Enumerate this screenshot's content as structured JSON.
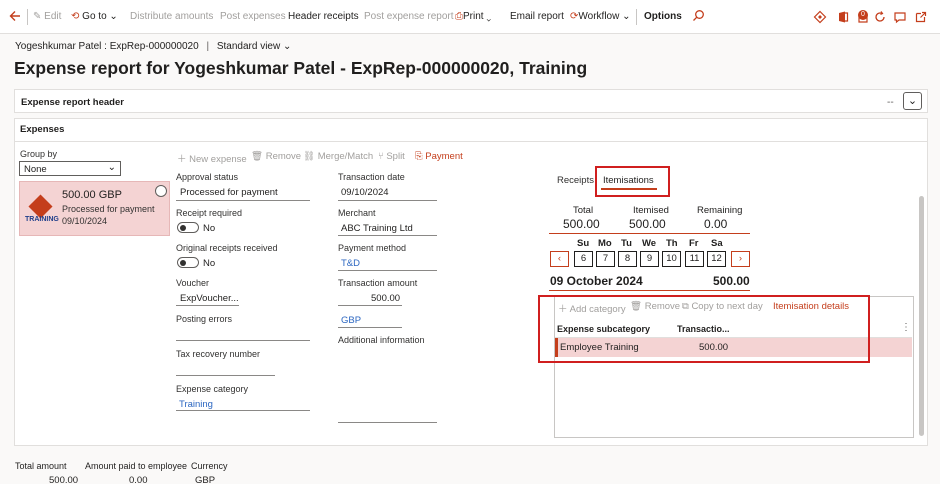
{
  "toolbar": {
    "edit": "Edit",
    "goto": "Go to",
    "distribute": "Distribute amounts",
    "post_expenses": "Post expenses",
    "header_receipts": "Header receipts",
    "post_report": "Post expense report",
    "print": "Print",
    "email_report": "Email report",
    "workflow": "Workflow",
    "options": "Options",
    "notification_count": "0"
  },
  "breadcrumb": {
    "record": "Yogeshkumar Patel : ExpRep-000000020",
    "view": "Standard view"
  },
  "page_title": "Expense report for Yogeshkumar Patel - ExpRep-000000020, Training",
  "header_section": {
    "title": "Expense report header",
    "dashes": "--"
  },
  "expenses": {
    "title": "Expenses",
    "group_by_label": "Group by",
    "group_by_value": "None",
    "card": {
      "amount": "500.00 GBP",
      "status": "Processed for payment",
      "date": "09/10/2024",
      "category_badge": "TRAINING"
    },
    "actions": {
      "new_expense": "New expense",
      "remove": "Remove",
      "merge": "Merge/Match",
      "split": "Split",
      "payment": "Payment"
    },
    "fields": {
      "approval_status_label": "Approval status",
      "approval_status": "Processed for payment",
      "receipt_required_label": "Receipt required",
      "receipt_required": "No",
      "original_receipts_label": "Original receipts received",
      "original_receipts": "No",
      "voucher_label": "Voucher",
      "voucher": "ExpVoucher...",
      "posting_errors_label": "Posting errors",
      "tax_recovery_label": "Tax recovery number",
      "expense_category_label": "Expense category",
      "expense_category": "Training",
      "transaction_date_label": "Transaction date",
      "transaction_date": "09/10/2024",
      "merchant_label": "Merchant",
      "merchant": "ABC Training Ltd",
      "payment_method_label": "Payment method",
      "payment_method": "T&D",
      "transaction_amount_label": "Transaction amount",
      "transaction_amount": "500.00",
      "currency": "GBP",
      "additional_info_label": "Additional information"
    }
  },
  "itemisation": {
    "tabs": [
      "Receipts",
      "Itemisations"
    ],
    "total_label": "Total",
    "total": "500.00",
    "itemised_label": "Itemised",
    "itemised": "500.00",
    "remaining_label": "Remaining",
    "remaining": "0.00",
    "weekdays": [
      "Su",
      "Mo",
      "Tu",
      "We",
      "Th",
      "Fr",
      "Sa"
    ],
    "days": [
      "6",
      "7",
      "8",
      "9",
      "10",
      "11",
      "12"
    ],
    "selected_date": "09 October 2024",
    "selected_amount": "500.00",
    "actions": {
      "add_category": "Add category",
      "remove": "Remove",
      "copy": "Copy to next day",
      "details": "Itemisation details"
    },
    "columns": [
      "Expense subcategory",
      "Transactio..."
    ],
    "rows": [
      {
        "subcategory": "Employee Training",
        "amount": "500.00"
      }
    ]
  },
  "footer": {
    "total_amount_label": "Total amount",
    "total_amount": "500.00",
    "paid_label": "Amount paid to employee",
    "paid": "0.00",
    "currency_label": "Currency",
    "currency": "GBP"
  },
  "colors": {
    "accent": "#c43e1c",
    "highlight_box": "#d01f1f",
    "card_bg": "#f4d3d3",
    "link": "#2b66c1"
  }
}
